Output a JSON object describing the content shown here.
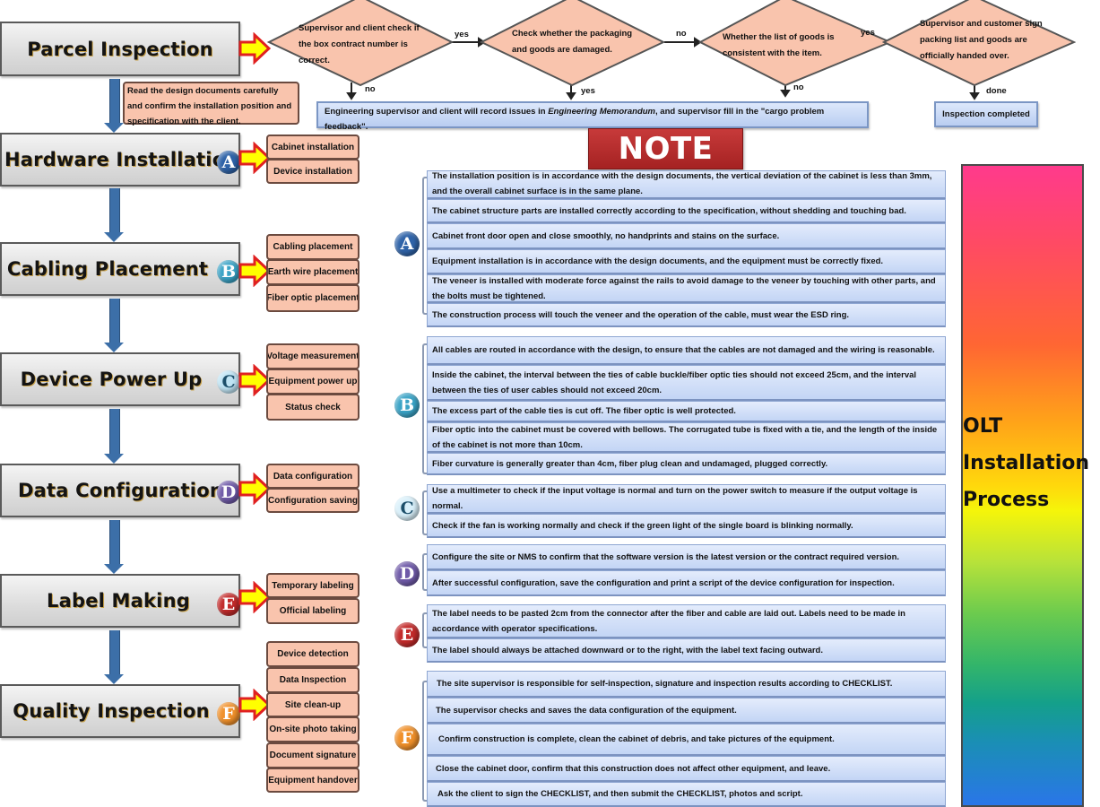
{
  "title": {
    "lines": [
      "OLT",
      "Installation",
      "Process"
    ]
  },
  "note_banner": "NOTE",
  "stages": [
    {
      "label": "Parcel Inspection",
      "badge": ""
    },
    {
      "label": "Hardware Installation",
      "badge": "A"
    },
    {
      "label": "Cabling Placement",
      "badge": "B"
    },
    {
      "label": "Device Power Up",
      "badge": "C"
    },
    {
      "label": "Data Configuration",
      "badge": "D"
    },
    {
      "label": "Label Making",
      "badge": "E"
    },
    {
      "label": "Quality Inspection",
      "badge": "F"
    }
  ],
  "badge_colors": {
    "A": "#2f63a8",
    "B": "#3aa3c6",
    "C": "#bfe4f4",
    "D": "#6f5aa8",
    "E": "#c22a2a",
    "F": "#f0902a"
  },
  "parcel_note": "Read the design documents carefully and confirm the installation position and specification with the client.",
  "decisions": [
    {
      "text": "Supervisor and client check if the box contract number is correct."
    },
    {
      "text": "Check whether the packaging and goods are damaged."
    },
    {
      "text": "Whether the list of goods is consistent with the item."
    },
    {
      "text": "Supervisor and customer sign packing list and goods are officially handed over."
    }
  ],
  "flow_labels": {
    "d1_to_d2": "yes",
    "d2_to_d3": "no",
    "d3_to_d4": "yes",
    "d1_down": "no",
    "d2_down": "yes",
    "d3_down": "no",
    "d4_down": "done"
  },
  "issue_box": {
    "prefix": "Engineering supervisor and client will record issues in ",
    "italic": "Engineering Memorandum",
    "suffix": ", and supervisor fill in the \"cargo problem feedback\"."
  },
  "completed_box": "Inspection completed",
  "substeps": {
    "A": [
      "Cabinet installation",
      "Device installation"
    ],
    "B": [
      "Cabling placement",
      "Earth wire placement",
      "Fiber optic placement"
    ],
    "C": [
      "Voltage measurement",
      "Equipment power up",
      "Status check"
    ],
    "D": [
      "Data configuration",
      "Configuration saving"
    ],
    "E": [
      "Temporary labeling",
      "Official labeling"
    ],
    "F": [
      "Device detection",
      "Data Inspection",
      "Site clean-up",
      "On-site photo taking",
      "Document signature",
      "Equipment handover"
    ]
  },
  "notes": {
    "A": [
      "The installation position is in accordance with the design documents, the vertical deviation of the cabinet is less than 3mm, and the overall cabinet surface is in the same plane.",
      "The cabinet structure parts are installed correctly according to the specification, without shedding and touching bad.",
      "Cabinet front door open and close smoothly, no handprints and stains on the surface.",
      "Equipment installation is in accordance with the design documents, and the equipment must be correctly fixed.",
      "The veneer is installed with moderate force against the rails to avoid damage to the veneer by touching with other parts, and the bolts must be tightened.",
      "The construction process will touch the veneer and the operation of the cable, must wear the ESD ring."
    ],
    "B": [
      "All cables are routed in accordance with the design, to ensure that the cables are not damaged and the wiring is reasonable.",
      "Inside the cabinet, the interval between the ties of cable buckle/fiber optic ties should not exceed 25cm, and the interval between the ties of user cables should not exceed 20cm.",
      "The excess part of the cable ties is cut off. The fiber optic is well protected.",
      "Fiber optic into the cabinet must be covered with bellows. The corrugated tube is fixed with a tie, and the length of the inside of the cabinet is not more than 10cm.",
      "Fiber curvature is generally greater than 4cm, fiber plug clean and undamaged, plugged correctly."
    ],
    "C": [
      "Use a multimeter to check if the input voltage is normal and turn on the power switch to measure if the output voltage is normal.",
      "Check if the fan is working normally and check if the green light of the single board is blinking normally."
    ],
    "D": [
      "Configure the site or NMS to confirm that the software version is the latest version or the contract required version.",
      "After successful configuration, save the configuration and print a script of the device configuration for inspection."
    ],
    "E": [
      "The label needs to be pasted 2cm from the connector after the fiber and cable are laid out. Labels need to be made in accordance with operator specifications.",
      "The label should always be attached downward or to the right, with the label text facing outward."
    ],
    "F": [
      "The site supervisor is responsible for self-inspection, signature and inspection results according to CHECKLIST.",
      "The supervisor checks and saves the data configuration of the equipment.",
      "Confirm construction is complete, clean the cabinet of debris, and take pictures of the equipment.",
      "Close the cabinet door, confirm that this construction does not affect other equipment, and leave.",
      "Ask the client to sign the CHECKLIST, and then submit the CHECKLIST, photos and script."
    ]
  },
  "colors": {
    "stage_border": "#5a5a5a",
    "substep_fill": "#f9c4ad",
    "note_fill": "#c3d5f5",
    "note_banner": "#b02a2a",
    "arrow_fill": "#ffff00",
    "arrow_outline": "#e02020",
    "down_arrow": "#3c6fa8"
  }
}
